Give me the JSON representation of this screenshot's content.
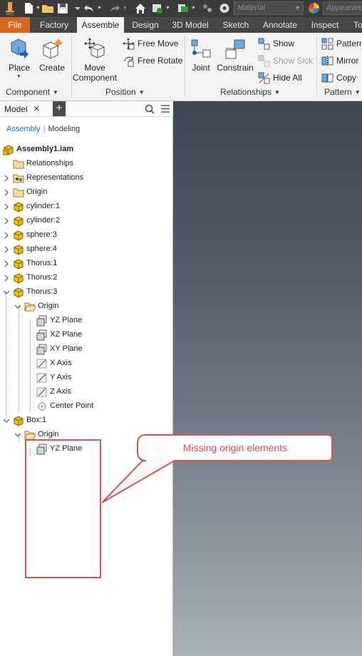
{
  "quick_access": {
    "material_placeholder": "Material",
    "appearance_placeholder": "Appearance"
  },
  "tabs": [
    "File",
    "Factory",
    "Assemble",
    "Design",
    "3D Model",
    "Sketch",
    "Annotate",
    "Inspect",
    "To"
  ],
  "active_tab": "Assemble",
  "ribbon": {
    "component": {
      "title": "Component",
      "place": "Place",
      "create": "Create"
    },
    "position": {
      "title": "Position",
      "move_line1": "Move",
      "move_line2": "Component",
      "free_move": "Free Move",
      "free_rotate": "Free Rotate"
    },
    "relationships": {
      "title": "Relationships",
      "joint": "Joint",
      "constrain": "Constrain",
      "show": "Show",
      "show_sick": "Show Sick",
      "hide_all": "Hide All"
    },
    "pattern": {
      "title": "Pattern",
      "pattern": "Pattern",
      "mirror": "Mirror",
      "copy": "Copy"
    }
  },
  "browser": {
    "tab_label": "Model",
    "mode_assembly": "Assembly",
    "mode_modeling": "Modeling",
    "tree": [
      {
        "label": "Assembly1.iam",
        "bold": true
      },
      {
        "label": "Relationships"
      },
      {
        "label": "Representations"
      },
      {
        "label": "Origin"
      },
      {
        "label": "cylinder:1"
      },
      {
        "label": "cylinder:2"
      },
      {
        "label": "sphere:3"
      },
      {
        "label": "sphere:4"
      },
      {
        "label": "Thorus:1"
      },
      {
        "label": "Thorus:2"
      },
      {
        "label": "Thorus:3"
      },
      {
        "label": "Origin"
      },
      {
        "label": "YZ Plane"
      },
      {
        "label": "XZ Plane"
      },
      {
        "label": "XY Plane"
      },
      {
        "label": "X Axis"
      },
      {
        "label": "Y Axis"
      },
      {
        "label": "Z Axis"
      },
      {
        "label": "Center Point"
      },
      {
        "label": "Box:1"
      },
      {
        "label": "Origin"
      },
      {
        "label": "YZ Plane"
      }
    ]
  },
  "annotation": {
    "callout_text": "Missing origin elements",
    "color": "#d9534f"
  },
  "colors": {
    "file_tab": "#d2691e",
    "link_blue": "#1a6fc4",
    "part_yellow": "#f2c200"
  }
}
